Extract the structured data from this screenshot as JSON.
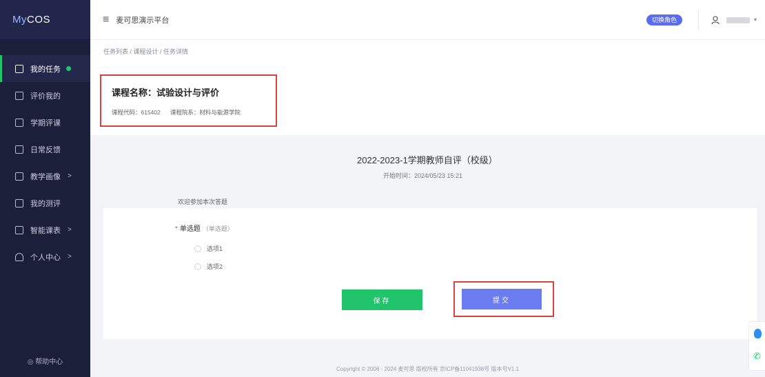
{
  "sidebar": {
    "logo_prefix": "My",
    "logo_suffix": "COS",
    "items": [
      {
        "label": "我的任务"
      },
      {
        "label": "评价我的"
      },
      {
        "label": "学期评课"
      },
      {
        "label": "日常反馈"
      },
      {
        "label": "教学画像"
      },
      {
        "label": "我的测评"
      },
      {
        "label": "智能课表"
      },
      {
        "label": "个人中心"
      }
    ],
    "help": "◎ 帮助中心"
  },
  "topbar": {
    "menu_icon": "≡",
    "platform": "麦可思演示平台",
    "badge": "切换角色",
    "user_icon": "user-icon"
  },
  "breadcrumb": "任务列表 / 课程设计 / 任务详情",
  "course": {
    "title": "课程名称：试验设计与评价",
    "code": "课程代码：615402",
    "department": "课程院系：材料与能源学院"
  },
  "survey": {
    "title": "2022-2023-1学期教师自评（校级）",
    "start_time": "开始时间：2024/05/23 15:21",
    "welcome": "欢迎参加本次答题"
  },
  "question": {
    "required_mark": "*",
    "label": "单选题",
    "hint": "（单选题）",
    "options": [
      "选项1",
      "选项2"
    ]
  },
  "buttons": {
    "save": "保存",
    "submit": "提交"
  },
  "footer": "Copyright © 2006 - 2024 麦可思 版权所有 京ICP备11041938号 版本号V1.1",
  "colors": {
    "sidebar_bg": "#1c1f3a",
    "accent_green": "#21c46b",
    "accent_blue": "#6b7cf0",
    "highlight_red": "#d9413a"
  }
}
